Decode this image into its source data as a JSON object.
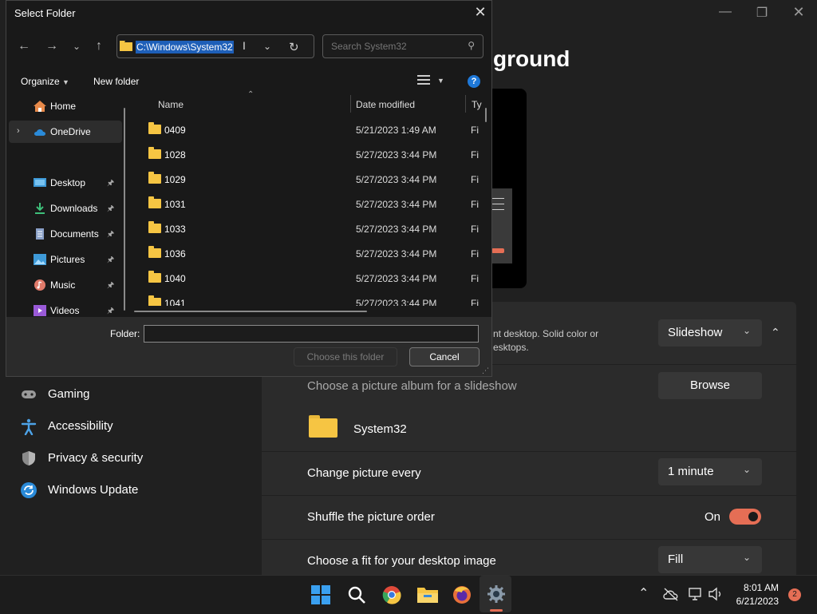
{
  "settings": {
    "page_title_partial": "ground",
    "background_type": {
      "desc_line1": "nt desktop. Solid color or",
      "desc_line2": "esktops.",
      "value": "Slideshow"
    },
    "album": {
      "label": "Choose a picture album for a slideshow",
      "browse_label": "Browse",
      "folder_name": "System32"
    },
    "change_every": {
      "label": "Change picture every",
      "value": "1 minute"
    },
    "shuffle": {
      "label": "Shuffle the picture order",
      "state": "On"
    },
    "fit": {
      "label": "Choose a fit for your desktop image",
      "value": "Fill"
    },
    "nav": [
      {
        "label": "Gaming",
        "icon": "gamepad-icon"
      },
      {
        "label": "Accessibility",
        "icon": "accessibility-icon"
      },
      {
        "label": "Privacy & security",
        "icon": "shield-icon"
      },
      {
        "label": "Windows Update",
        "icon": "update-icon"
      }
    ],
    "accent": "#e56e55"
  },
  "dialog": {
    "title": "Select Folder",
    "address": "C:\\Windows\\System32",
    "search_placeholder": "Search System32",
    "toolbar": {
      "organize": "Organize",
      "new_folder": "New folder"
    },
    "nav_pane": [
      {
        "label": "Home",
        "icon": "home-icon"
      },
      {
        "label": "OneDrive",
        "icon": "cloud-icon"
      },
      {
        "label": "Desktop",
        "icon": "desktop-icon"
      },
      {
        "label": "Downloads",
        "icon": "download-icon"
      },
      {
        "label": "Documents",
        "icon": "document-icon"
      },
      {
        "label": "Pictures",
        "icon": "pictures-icon"
      },
      {
        "label": "Music",
        "icon": "music-icon"
      },
      {
        "label": "Videos",
        "icon": "videos-icon"
      }
    ],
    "columns": {
      "name": "Name",
      "date": "Date modified",
      "type": "Ty"
    },
    "files": [
      {
        "name": "0409",
        "date": "5/21/2023 1:49 AM",
        "type": "Fi"
      },
      {
        "name": "1028",
        "date": "5/27/2023 3:44 PM",
        "type": "Fi"
      },
      {
        "name": "1029",
        "date": "5/27/2023 3:44 PM",
        "type": "Fi"
      },
      {
        "name": "1031",
        "date": "5/27/2023 3:44 PM",
        "type": "Fi"
      },
      {
        "name": "1033",
        "date": "5/27/2023 3:44 PM",
        "type": "Fi"
      },
      {
        "name": "1036",
        "date": "5/27/2023 3:44 PM",
        "type": "Fi"
      },
      {
        "name": "1040",
        "date": "5/27/2023 3:44 PM",
        "type": "Fi"
      },
      {
        "name": "1041",
        "date": "5/27/2023 3:44 PM",
        "type": "Fi"
      }
    ],
    "folder_label": "Folder:",
    "folder_value": "",
    "choose_label": "Choose this folder",
    "cancel_label": "Cancel"
  },
  "taskbar": {
    "time": "8:01 AM",
    "date": "6/21/2023",
    "notification_count": "2"
  }
}
